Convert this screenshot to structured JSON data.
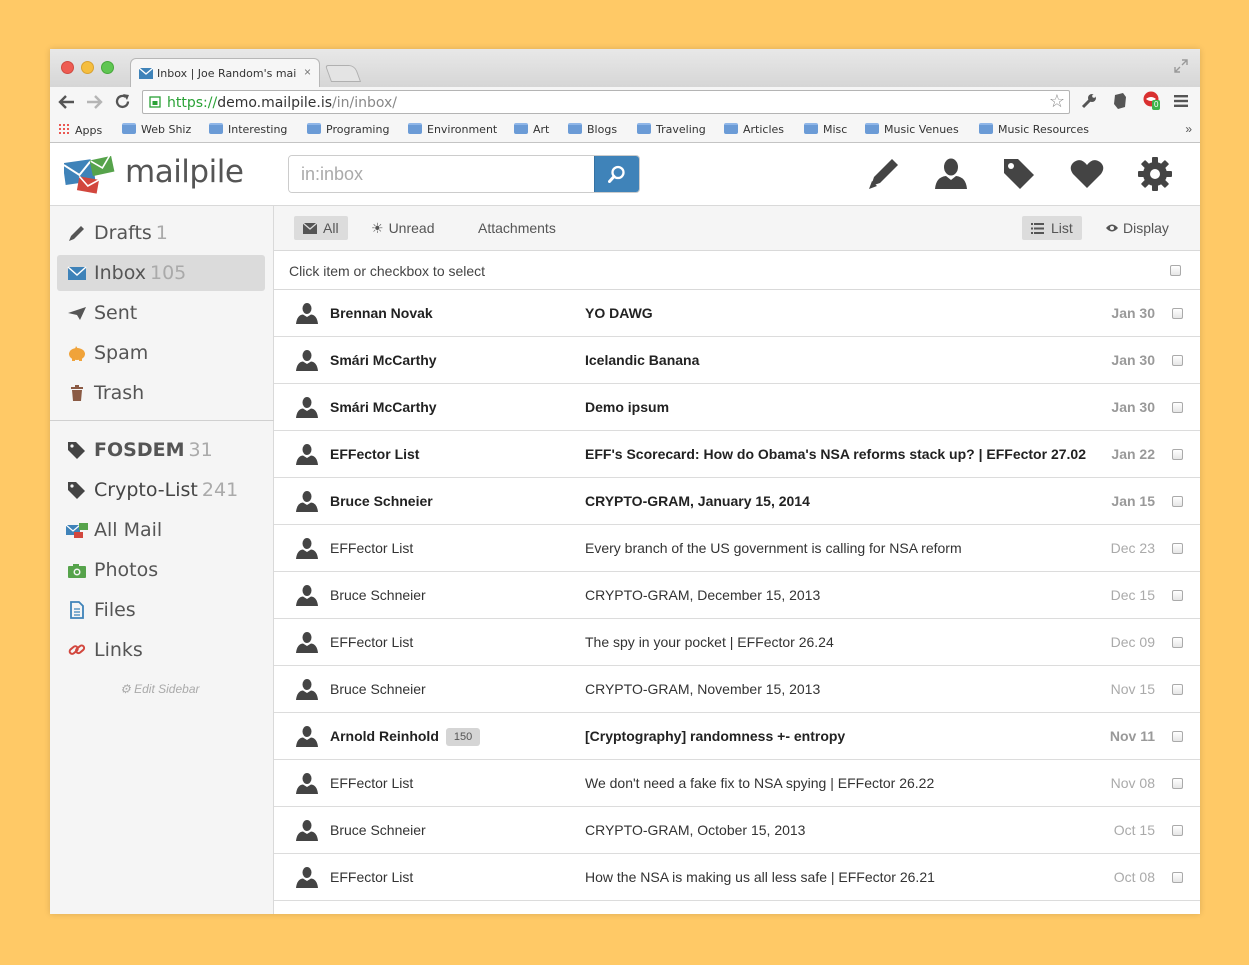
{
  "browser": {
    "tab_title": "Inbox | Joe Random's mail",
    "tab_close": "×",
    "url_scheme": "https://",
    "url_host": "demo.mailpile.is",
    "url_path": "/in/inbox/",
    "bookmarks": [
      "Apps",
      "Web Shiz",
      "Interesting",
      "Programing",
      "Environment",
      "Art",
      "Blogs",
      "Traveling",
      "Articles",
      "Misc",
      "Music Venues",
      "Music Resources"
    ],
    "bookmarks_more": "»",
    "extension_badge": "0"
  },
  "app": {
    "logo_text": "mailpile",
    "search_value": "in:inbox"
  },
  "sidebar": {
    "items": [
      {
        "label": "Drafts",
        "count": "1",
        "icon": "pencil-icon"
      },
      {
        "label": "Inbox",
        "count": "105",
        "icon": "envelope-icon"
      },
      {
        "label": "Sent",
        "count": "",
        "icon": "paper-plane-icon"
      },
      {
        "label": "Spam",
        "count": "",
        "icon": "pig-icon"
      },
      {
        "label": "Trash",
        "count": "",
        "icon": "trash-icon"
      }
    ],
    "tags": [
      {
        "label": "FOSDEM",
        "count": "31",
        "icon": "tag-icon"
      },
      {
        "label": "Crypto-List",
        "count": "241",
        "icon": "tag-icon"
      },
      {
        "label": "All Mail",
        "count": "",
        "icon": "envelopes-icon"
      },
      {
        "label": "Photos",
        "count": "",
        "icon": "camera-icon"
      },
      {
        "label": "Files",
        "count": "",
        "icon": "document-icon"
      },
      {
        "label": "Links",
        "count": "",
        "icon": "link-icon"
      }
    ],
    "edit_label": "Edit Sidebar"
  },
  "filters": {
    "all": "All",
    "unread": "Unread",
    "attachments": "Attachments",
    "list": "List",
    "display": "Display"
  },
  "select_hint": "Click item or checkbox to select",
  "messages": [
    {
      "from": "Brennan Novak",
      "subject": "YO DAWG",
      "date": "Jan 30",
      "unread": true,
      "count": ""
    },
    {
      "from": "Smári McCarthy",
      "subject": "Icelandic Banana",
      "date": "Jan 30",
      "unread": true,
      "count": ""
    },
    {
      "from": "Smári McCarthy",
      "subject": "Demo ipsum",
      "date": "Jan 30",
      "unread": true,
      "count": ""
    },
    {
      "from": "EFFector List",
      "subject": "EFF's Scorecard: How do Obama's NSA reforms stack up? | EFFector 27.02",
      "date": "Jan 22",
      "unread": true,
      "count": ""
    },
    {
      "from": "Bruce Schneier",
      "subject": "CRYPTO-GRAM, January 15, 2014",
      "date": "Jan 15",
      "unread": true,
      "count": ""
    },
    {
      "from": "EFFector List",
      "subject": "Every branch of the US government is calling for NSA reform",
      "date": "Dec 23",
      "unread": false,
      "count": ""
    },
    {
      "from": "Bruce Schneier",
      "subject": "CRYPTO-GRAM, December 15, 2013",
      "date": "Dec 15",
      "unread": false,
      "count": ""
    },
    {
      "from": "EFFector List",
      "subject": "The spy in your pocket | EFFector 26.24",
      "date": "Dec 09",
      "unread": false,
      "count": ""
    },
    {
      "from": "Bruce Schneier",
      "subject": "CRYPTO-GRAM, November 15, 2013",
      "date": "Nov 15",
      "unread": false,
      "count": ""
    },
    {
      "from": "Arnold Reinhold",
      "subject": "[Cryptography] randomness +- entropy",
      "date": "Nov 11",
      "unread": true,
      "count": "150"
    },
    {
      "from": "EFFector List",
      "subject": "We don't need a fake fix to NSA spying | EFFector 26.22",
      "date": "Nov 08",
      "unread": false,
      "count": ""
    },
    {
      "from": "Bruce Schneier",
      "subject": "CRYPTO-GRAM, October 15, 2013",
      "date": "Oct 15",
      "unread": false,
      "count": ""
    },
    {
      "from": "EFFector List",
      "subject": "How the NSA is making us all less safe | EFFector 26.21",
      "date": "Oct 08",
      "unread": false,
      "count": ""
    }
  ],
  "colors": {
    "accent": "#3f83b9",
    "background": "#ffc966",
    "sidebar_active": "#dbdbdb"
  }
}
